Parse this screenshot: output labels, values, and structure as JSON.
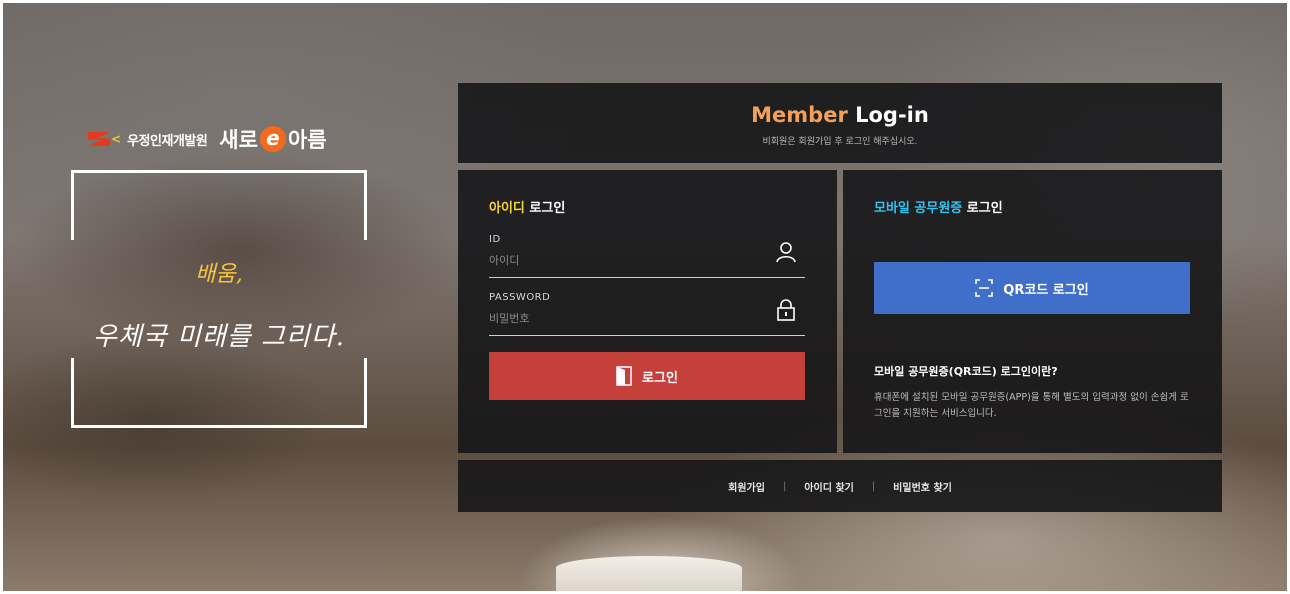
{
  "brand": {
    "org_name": "우정인재개발원",
    "service_name_prefix": "새로",
    "service_name_e": "e",
    "service_name_suffix": "아름"
  },
  "slogan": {
    "line1": "배움,",
    "line2": "우체국 미래를 그리다."
  },
  "header": {
    "title_member": "Member",
    "title_login": "Log-in",
    "subtitle": "비회원은 회원가입 후 로그인 해주십시오."
  },
  "id_login": {
    "title_highlight": "아이디",
    "title_rest": "로그인",
    "id_label": "ID",
    "id_placeholder": "아이디",
    "id_value": "",
    "password_label": "PASSWORD",
    "password_placeholder": "비밀번호",
    "password_value": "",
    "login_button": "로그인"
  },
  "mobile_login": {
    "title_highlight": "모바일 공무원증",
    "title_rest": "로그인",
    "qr_button": "QR코드 로그인",
    "info_title": "모바일 공무원증(QR코드) 로그인이란?",
    "info_desc": "휴대폰에 설치된 모바일 공무원증(APP)을 통해 별도의 입력과정 없이 손쉽게 로그인을 지원하는 서비스입니다."
  },
  "footer": {
    "links": [
      "회원가입",
      "아이디 찾기",
      "비밀번호 찾기"
    ],
    "separator": "|"
  },
  "colors": {
    "accent_yellow": "#f5d33a",
    "accent_blue": "#33c3f0",
    "login_red": "#c5403a",
    "qr_blue": "#3f6fc9",
    "member_orange": "#f4a05a"
  },
  "icons": {
    "id_field": "user-icon",
    "password_field": "lock-icon",
    "login_button": "door-icon",
    "qr_button": "qr-scan-icon"
  }
}
